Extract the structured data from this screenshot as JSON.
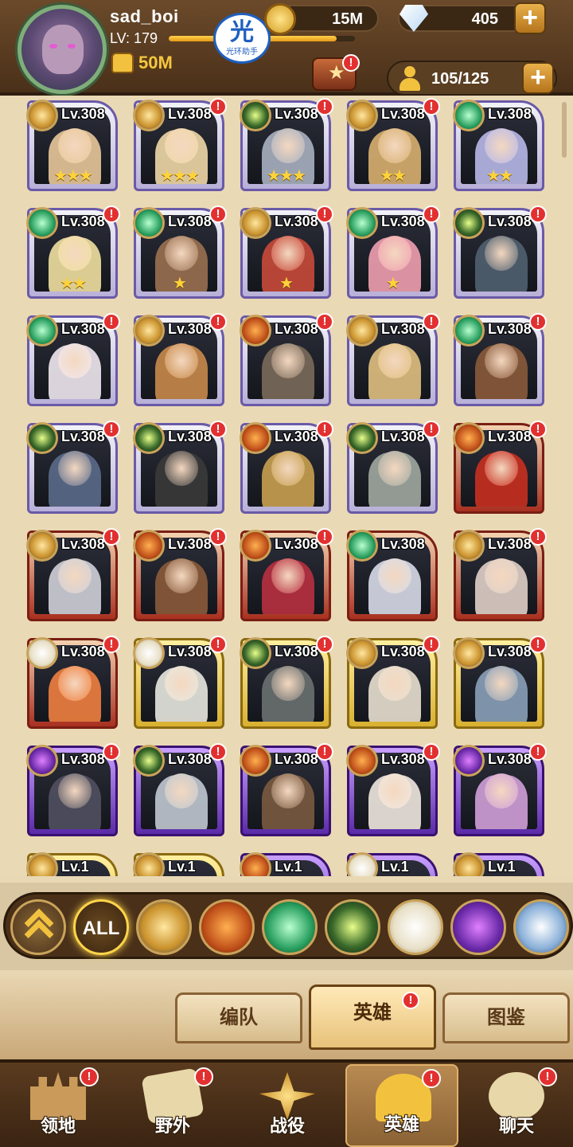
{
  "player": {
    "name": "sad_boi",
    "level": "LV: 179",
    "level_progress": 0.9,
    "power": "50M",
    "helper_badge": "光",
    "helper_text": "光环助手"
  },
  "currencies": {
    "gold": "15M",
    "gems": "405",
    "plus": "+"
  },
  "hero_count": {
    "value": "105/125",
    "plus": "+"
  },
  "alert_mark": "!",
  "heroes": [
    {
      "level": "Lv.308",
      "faction": "lightbearer",
      "rarity": "purple",
      "stars": "★★★",
      "alert": false,
      "color": "#e8c89a"
    },
    {
      "level": "Lv.308",
      "faction": "lightbearer",
      "rarity": "purple",
      "stars": "★★★",
      "alert": true,
      "color": "#f0d8a8"
    },
    {
      "level": "Lv.308",
      "faction": "graveborn",
      "rarity": "purple",
      "stars": "★★★",
      "alert": true,
      "color": "#a8b0c0"
    },
    {
      "level": "Lv.308",
      "faction": "lightbearer",
      "rarity": "purple",
      "stars": "★★",
      "alert": true,
      "color": "#d8b070"
    },
    {
      "level": "Lv.308",
      "faction": "wilder",
      "rarity": "purple",
      "stars": "★★",
      "alert": false,
      "color": "#b8b8e8"
    },
    {
      "level": "Lv.308",
      "faction": "wilder",
      "rarity": "purple",
      "stars": "★★",
      "alert": true,
      "color": "#f0e0a0"
    },
    {
      "level": "Lv.308",
      "faction": "wilder",
      "rarity": "purple",
      "stars": "★",
      "alert": true,
      "color": "#9a7050"
    },
    {
      "level": "Lv.308",
      "faction": "lightbearer",
      "rarity": "purple",
      "stars": "★",
      "alert": true,
      "color": "#c84a3a"
    },
    {
      "level": "Lv.308",
      "faction": "wilder",
      "rarity": "purple",
      "stars": "★",
      "alert": true,
      "color": "#f0a0b0"
    },
    {
      "level": "Lv.308",
      "faction": "graveborn",
      "rarity": "purple",
      "stars": "",
      "alert": true,
      "color": "#506070"
    },
    {
      "level": "Lv.308",
      "faction": "wilder",
      "rarity": "purple",
      "stars": "",
      "alert": true,
      "color": "#f0e8f0"
    },
    {
      "level": "Lv.308",
      "faction": "lightbearer",
      "rarity": "purple",
      "stars": "",
      "alert": true,
      "color": "#c88a4a"
    },
    {
      "level": "Lv.308",
      "faction": "mauler",
      "rarity": "purple",
      "stars": "",
      "alert": true,
      "color": "#7a6a5a"
    },
    {
      "level": "Lv.308",
      "faction": "lightbearer",
      "rarity": "purple",
      "stars": "",
      "alert": true,
      "color": "#e0c080"
    },
    {
      "level": "Lv.308",
      "faction": "wilder",
      "rarity": "purple",
      "stars": "",
      "alert": true,
      "color": "#8a5a3a"
    },
    {
      "level": "Lv.308",
      "faction": "graveborn",
      "rarity": "purple",
      "stars": "",
      "alert": true,
      "color": "#5a6a8a"
    },
    {
      "level": "Lv.308",
      "faction": "graveborn",
      "rarity": "purple",
      "stars": "",
      "alert": true,
      "color": "#3a3a3a"
    },
    {
      "level": "Lv.308",
      "faction": "mauler",
      "rarity": "purple",
      "stars": "",
      "alert": true,
      "color": "#c8a050"
    },
    {
      "level": "Lv.308",
      "faction": "graveborn",
      "rarity": "purple",
      "stars": "",
      "alert": true,
      "color": "#a0a8a0"
    },
    {
      "level": "Lv.308",
      "faction": "mauler",
      "rarity": "red",
      "stars": "",
      "alert": true,
      "color": "#c83020"
    },
    {
      "level": "Lv.308",
      "faction": "lightbearer",
      "rarity": "red",
      "stars": "",
      "alert": true,
      "color": "#d0d0d8"
    },
    {
      "level": "Lv.308",
      "faction": "mauler",
      "rarity": "red",
      "stars": "",
      "alert": true,
      "color": "#8a5a3a"
    },
    {
      "level": "Lv.308",
      "faction": "mauler",
      "rarity": "red",
      "stars": "",
      "alert": true,
      "color": "#b83040"
    },
    {
      "level": "Lv.308",
      "faction": "wilder",
      "rarity": "red",
      "stars": "",
      "alert": false,
      "color": "#d8dce8"
    },
    {
      "level": "Lv.308",
      "faction": "lightbearer",
      "rarity": "red",
      "stars": "",
      "alert": true,
      "color": "#e0d0c8"
    },
    {
      "level": "Lv.308",
      "faction": "celestial",
      "rarity": "red",
      "stars": "",
      "alert": true,
      "color": "#f08040"
    },
    {
      "level": "Lv.308",
      "faction": "celestial",
      "rarity": "gold",
      "stars": "",
      "alert": true,
      "color": "#e8e8e0"
    },
    {
      "level": "Lv.308",
      "faction": "graveborn",
      "rarity": "gold",
      "stars": "",
      "alert": true,
      "color": "#6a7070"
    },
    {
      "level": "Lv.308",
      "faction": "lightbearer",
      "rarity": "gold",
      "stars": "",
      "alert": true,
      "color": "#e8e0d0"
    },
    {
      "level": "Lv.308",
      "faction": "lightbearer",
      "rarity": "gold",
      "stars": "",
      "alert": true,
      "color": "#8aa0b8"
    },
    {
      "level": "Lv.308",
      "faction": "hypogean",
      "rarity": "violet",
      "stars": "",
      "alert": true,
      "color": "#505060"
    },
    {
      "level": "Lv.308",
      "faction": "graveborn",
      "rarity": "violet",
      "stars": "",
      "alert": true,
      "color": "#c0c8d0"
    },
    {
      "level": "Lv.308",
      "faction": "mauler",
      "rarity": "violet",
      "stars": "",
      "alert": true,
      "color": "#7a5a40"
    },
    {
      "level": "Lv.308",
      "faction": "mauler",
      "rarity": "violet",
      "stars": "",
      "alert": true,
      "color": "#f0e8e0"
    },
    {
      "level": "Lv.308",
      "faction": "hypogean",
      "rarity": "violet",
      "stars": "",
      "alert": true,
      "color": "#d0a0d8"
    },
    {
      "level": "Lv.1",
      "faction": "lightbearer",
      "rarity": "gold",
      "stars": "",
      "alert": false,
      "color": "#c0a070"
    },
    {
      "level": "Lv.1",
      "faction": "lightbearer",
      "rarity": "gold",
      "stars": "",
      "alert": false,
      "color": "#c0a070"
    },
    {
      "level": "Lv.1",
      "faction": "mauler",
      "rarity": "violet",
      "stars": "",
      "alert": false,
      "color": "#8a6a9a"
    },
    {
      "level": "Lv.1",
      "faction": "celestial",
      "rarity": "violet",
      "stars": "",
      "alert": false,
      "color": "#8a6a9a"
    },
    {
      "level": "Lv.1",
      "faction": "lightbearer",
      "rarity": "violet",
      "stars": "",
      "alert": false,
      "color": "#8a6a9a"
    }
  ],
  "filters": {
    "all_label": "ALL",
    "factions": [
      "up",
      "all",
      "lightbearer",
      "mauler",
      "wilder",
      "graveborn",
      "celestial",
      "hypogean",
      "dimensional"
    ]
  },
  "sub_tabs": [
    {
      "label": "编队",
      "active": false,
      "alert": false
    },
    {
      "label": "英雄",
      "active": true,
      "alert": true
    },
    {
      "label": "图鉴",
      "active": false,
      "alert": false
    }
  ],
  "bottom_nav": [
    {
      "label": "领地",
      "icon": "castle-icon",
      "active": false,
      "alert": true
    },
    {
      "label": "野外",
      "icon": "scroll-map-icon",
      "active": false,
      "alert": true
    },
    {
      "label": "战役",
      "icon": "crossed-swords-icon",
      "active": false,
      "alert": false
    },
    {
      "label": "英雄",
      "icon": "helmet-icon",
      "active": true,
      "alert": true
    },
    {
      "label": "聊天",
      "icon": "chat-bubble-icon",
      "active": false,
      "alert": true
    }
  ]
}
